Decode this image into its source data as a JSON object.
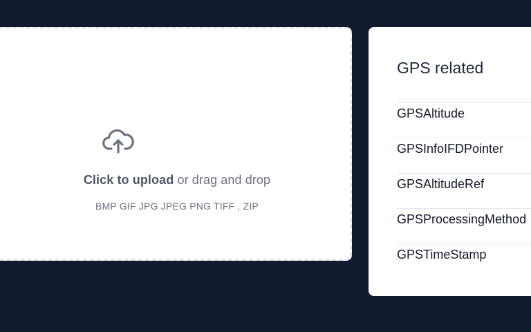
{
  "upload": {
    "click_text": "Click to upload",
    "drag_text": "or drag and drop",
    "formats_text": "BMP GIF JPG JPEG PNG TIFF , ZIP",
    "icon": "cloud-upload-icon"
  },
  "gps": {
    "title": "GPS related",
    "items": [
      {
        "label": "GPSAltitude"
      },
      {
        "label": "GPSInfoIFDPointer"
      },
      {
        "label": "GPSAltitudeRef"
      },
      {
        "label": "GPSProcessingMethod"
      },
      {
        "label": "GPSTimeStamp"
      }
    ]
  },
  "colors": {
    "background": "#111a2e",
    "card": "#ffffff",
    "muted_text": "#6b7280",
    "divider": "#e5e7eb"
  }
}
